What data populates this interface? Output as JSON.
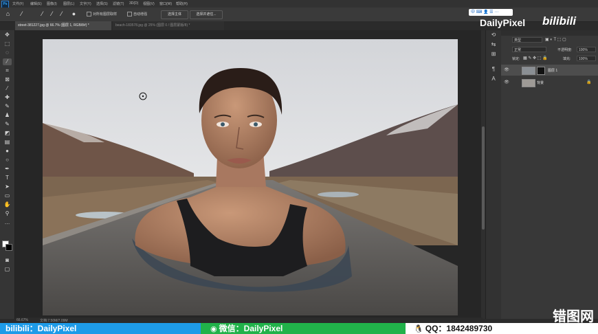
{
  "menubar": {
    "items": [
      "文件(F)",
      "编辑(E)",
      "图像(I)",
      "图层(L)",
      "文字(Y)",
      "选择(S)",
      "滤镜(T)",
      "3D(D)",
      "视图(V)",
      "窗口(W)",
      "帮助(H)"
    ]
  },
  "optionsbar": {
    "sample_all_layers": "对所有图层取样",
    "auto_enhance": "自动增强",
    "select_subject": "选择主体",
    "select_and_mask": "选择并遮住..."
  },
  "tabs": [
    {
      "label": "street-381227.jpg @ 66.7% (图层 1, RGB/8#) *",
      "active": true
    },
    {
      "label": "beach-183578.jpg @ 25% (图层 0 / 图层蒙版/8) *",
      "active": false
    }
  ],
  "statusbar": {
    "zoom": "66.67%",
    "doc": "文档:7.50M/7.09M"
  },
  "layers_panel": {
    "kind_filter": "类型",
    "blend_mode": "正常",
    "opacity_label": "不透明度:",
    "opacity_value": "100%",
    "lock_label": "锁定:",
    "fill_label": "填充:",
    "fill_value": "100%",
    "layers": [
      {
        "name": "图层 1",
        "selected": true
      },
      {
        "name": "背景",
        "selected": false
      }
    ]
  },
  "watermark": {
    "brand": "DailyPixel",
    "platform": "bilibili",
    "bottom_left": "bilibili：DailyPixel",
    "bottom_middle": "微信：DailyPixel",
    "bottom_right": "QQ：18424897̵̰",
    "bottom_right_display": "QQ：1842489730",
    "site": "错图网",
    "ime": "中"
  },
  "colors": {
    "accent_blue": "#1e9be8",
    "accent_green": "#21b24a",
    "panel_bg": "#383838"
  }
}
